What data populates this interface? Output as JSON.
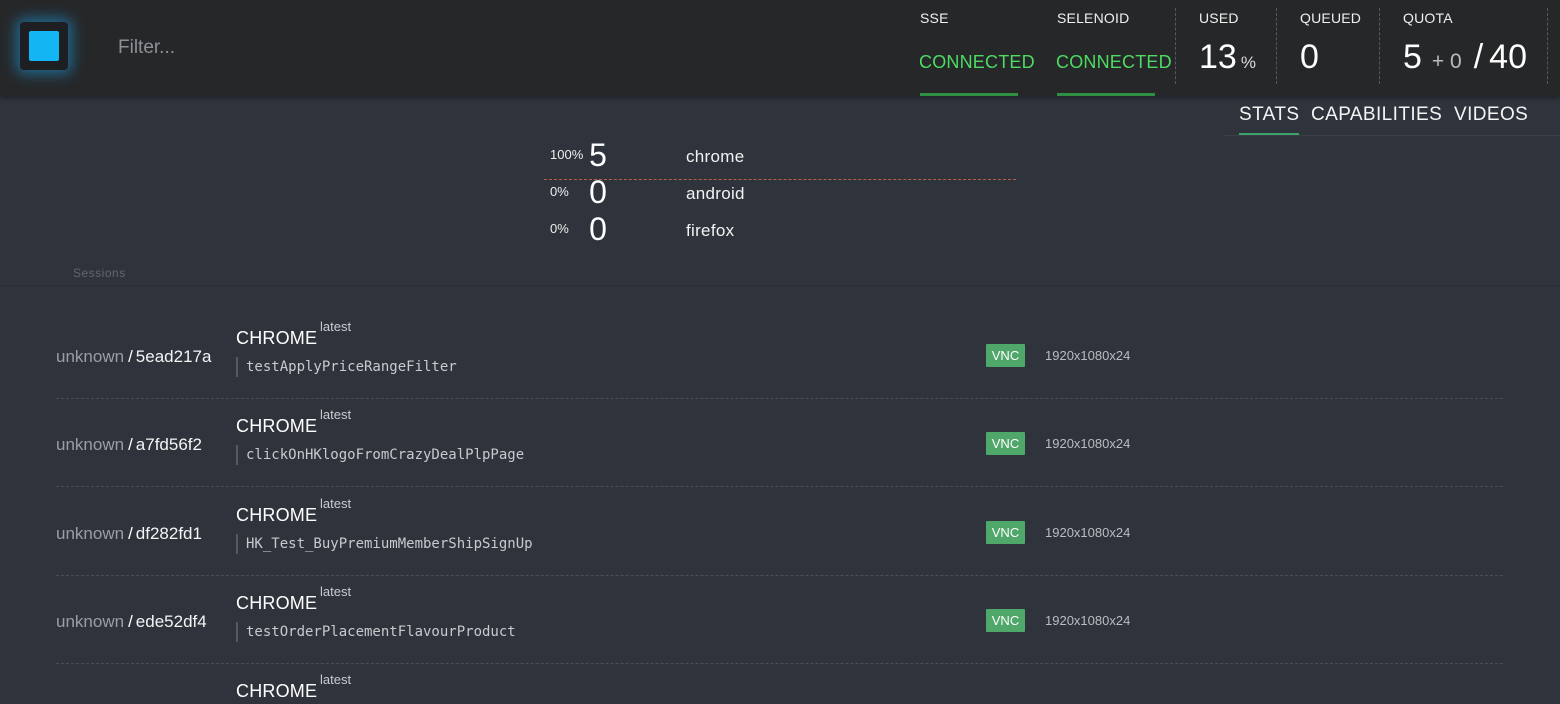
{
  "header": {
    "logo": "selenoid-logo-icon",
    "filter_placeholder": "Filter...",
    "sse": {
      "label": "SSE",
      "status": "CONNECTED"
    },
    "selenoid": {
      "label": "SELENOID",
      "status": "CONNECTED"
    },
    "used": {
      "label": "USED",
      "value": "13",
      "unit": "%"
    },
    "queued": {
      "label": "QUEUED",
      "value": "0"
    },
    "quota": {
      "label": "QUOTA",
      "running": "5",
      "plus": "+ 0",
      "total": "40"
    }
  },
  "tabs": [
    {
      "label": "STATS",
      "active": true
    },
    {
      "label": "CAPABILITIES",
      "active": false
    },
    {
      "label": "VIDEOS",
      "active": false
    }
  ],
  "browser_stats": [
    {
      "percent": "100%",
      "count": "5",
      "name": "chrome"
    },
    {
      "percent": "0%",
      "count": "0",
      "name": "android"
    },
    {
      "percent": "0%",
      "count": "0",
      "name": "firefox"
    }
  ],
  "sessions_label": "Sessions",
  "sessions": [
    {
      "user": "unknown",
      "id": "5ead217a",
      "browser": "CHROME",
      "version": "latest",
      "test": "testApplyPriceRangeFilter",
      "vnc": "VNC",
      "resolution": "1920x1080x24"
    },
    {
      "user": "unknown",
      "id": "a7fd56f2",
      "browser": "CHROME",
      "version": "latest",
      "test": "clickOnHKlogoFromCrazyDealPlpPage",
      "vnc": "VNC",
      "resolution": "1920x1080x24"
    },
    {
      "user": "unknown",
      "id": "df282fd1",
      "browser": "CHROME",
      "version": "latest",
      "test": "HK_Test_BuyPremiumMemberShipSignUp",
      "vnc": "VNC",
      "resolution": "1920x1080x24"
    },
    {
      "user": "unknown",
      "id": "ede52df4",
      "browser": "CHROME",
      "version": "latest",
      "test": "testOrderPlacementFlavourProduct",
      "vnc": "VNC",
      "resolution": "1920x1080x24"
    },
    {
      "browser": "CHROME",
      "version": "latest"
    }
  ],
  "colors": {
    "accent_green": "#4ddb62",
    "vnc_badge": "#4fa76a",
    "logo_blue": "#13b5f3",
    "background": "#2f343c",
    "header_bg": "#262729"
  }
}
